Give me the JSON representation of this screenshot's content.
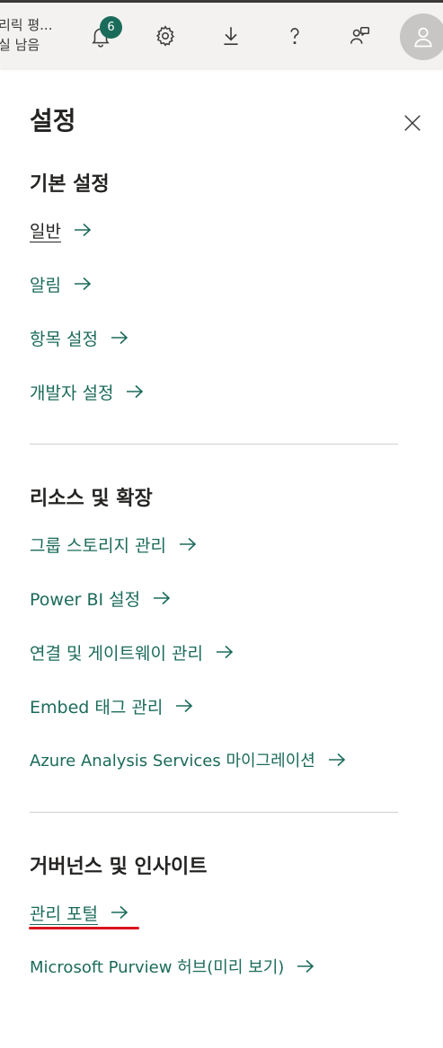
{
  "topbar": {
    "trial_line1": "리릭 평...",
    "trial_line2": "실 남음",
    "notification_count": "6",
    "icons": [
      "bell-icon",
      "gear-icon",
      "download-icon",
      "help-icon",
      "feedback-icon",
      "avatar-icon"
    ]
  },
  "panel": {
    "title": "설정",
    "sections": [
      {
        "title": "기본 설정",
        "links": [
          "일반",
          "알림",
          "항목 설정",
          "개발자 설정"
        ]
      },
      {
        "title": "리소스 및 확장",
        "links": [
          "그룹 스토리지 관리",
          "Power BI 설정",
          "연결 및 게이트웨이 관리",
          "Embed 태그 관리",
          "Azure Analysis Services 마이그레이션"
        ]
      },
      {
        "title": "거버넌스 및 인사이트",
        "links": [
          "관리 포털",
          "Microsoft Purview 허브(미리 보기)"
        ]
      }
    ]
  },
  "colors": {
    "accent": "#1b6b5a",
    "highlight": "#d9141e",
    "topbar_bg": "#f3f2f1"
  }
}
